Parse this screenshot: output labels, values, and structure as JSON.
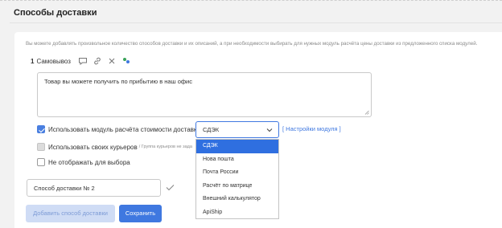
{
  "section": {
    "title": "Способы доставки"
  },
  "description": "Вы можете добавлять произвольное количество способов доставки и их описаний, а при необходимости выбирать для нужных модуль расчёта цены доставки из предложенного списка модулей.",
  "delivery_item": {
    "number": "1",
    "name": "Самовывоз",
    "icons": [
      "comment-icon",
      "link-icon",
      "close-icon",
      "puzzle-icon"
    ],
    "text": "Товар вы можете получить по прибытию в наш офис"
  },
  "options": {
    "use_module_label": "Использовать модуль расчёта стоимости доставки",
    "use_module_checked": true,
    "module_settings_link": "[ Настройки модуля ]",
    "use_couriers_label": "Использовать своих курьеров",
    "use_couriers_hint": "/ Группа курьеров не зада",
    "hide_label": "Не отображать для выбора"
  },
  "module_select": {
    "value": "СДЭК",
    "options": [
      "СДЭК",
      "Нова пошта",
      "Почта России",
      "Расчёт по матрице",
      "Внешний калькулятор",
      "ApiShip"
    ],
    "selected_index": 0
  },
  "new_item": {
    "value": "Способ доставки № 2"
  },
  "buttons": {
    "add_label": "Добавить способ доставки",
    "save_label": "Сохранить"
  },
  "colors": {
    "accent": "#3f78e0",
    "selected_option": "#2f6fe0",
    "add_button_bg": "#cfdcf5"
  }
}
